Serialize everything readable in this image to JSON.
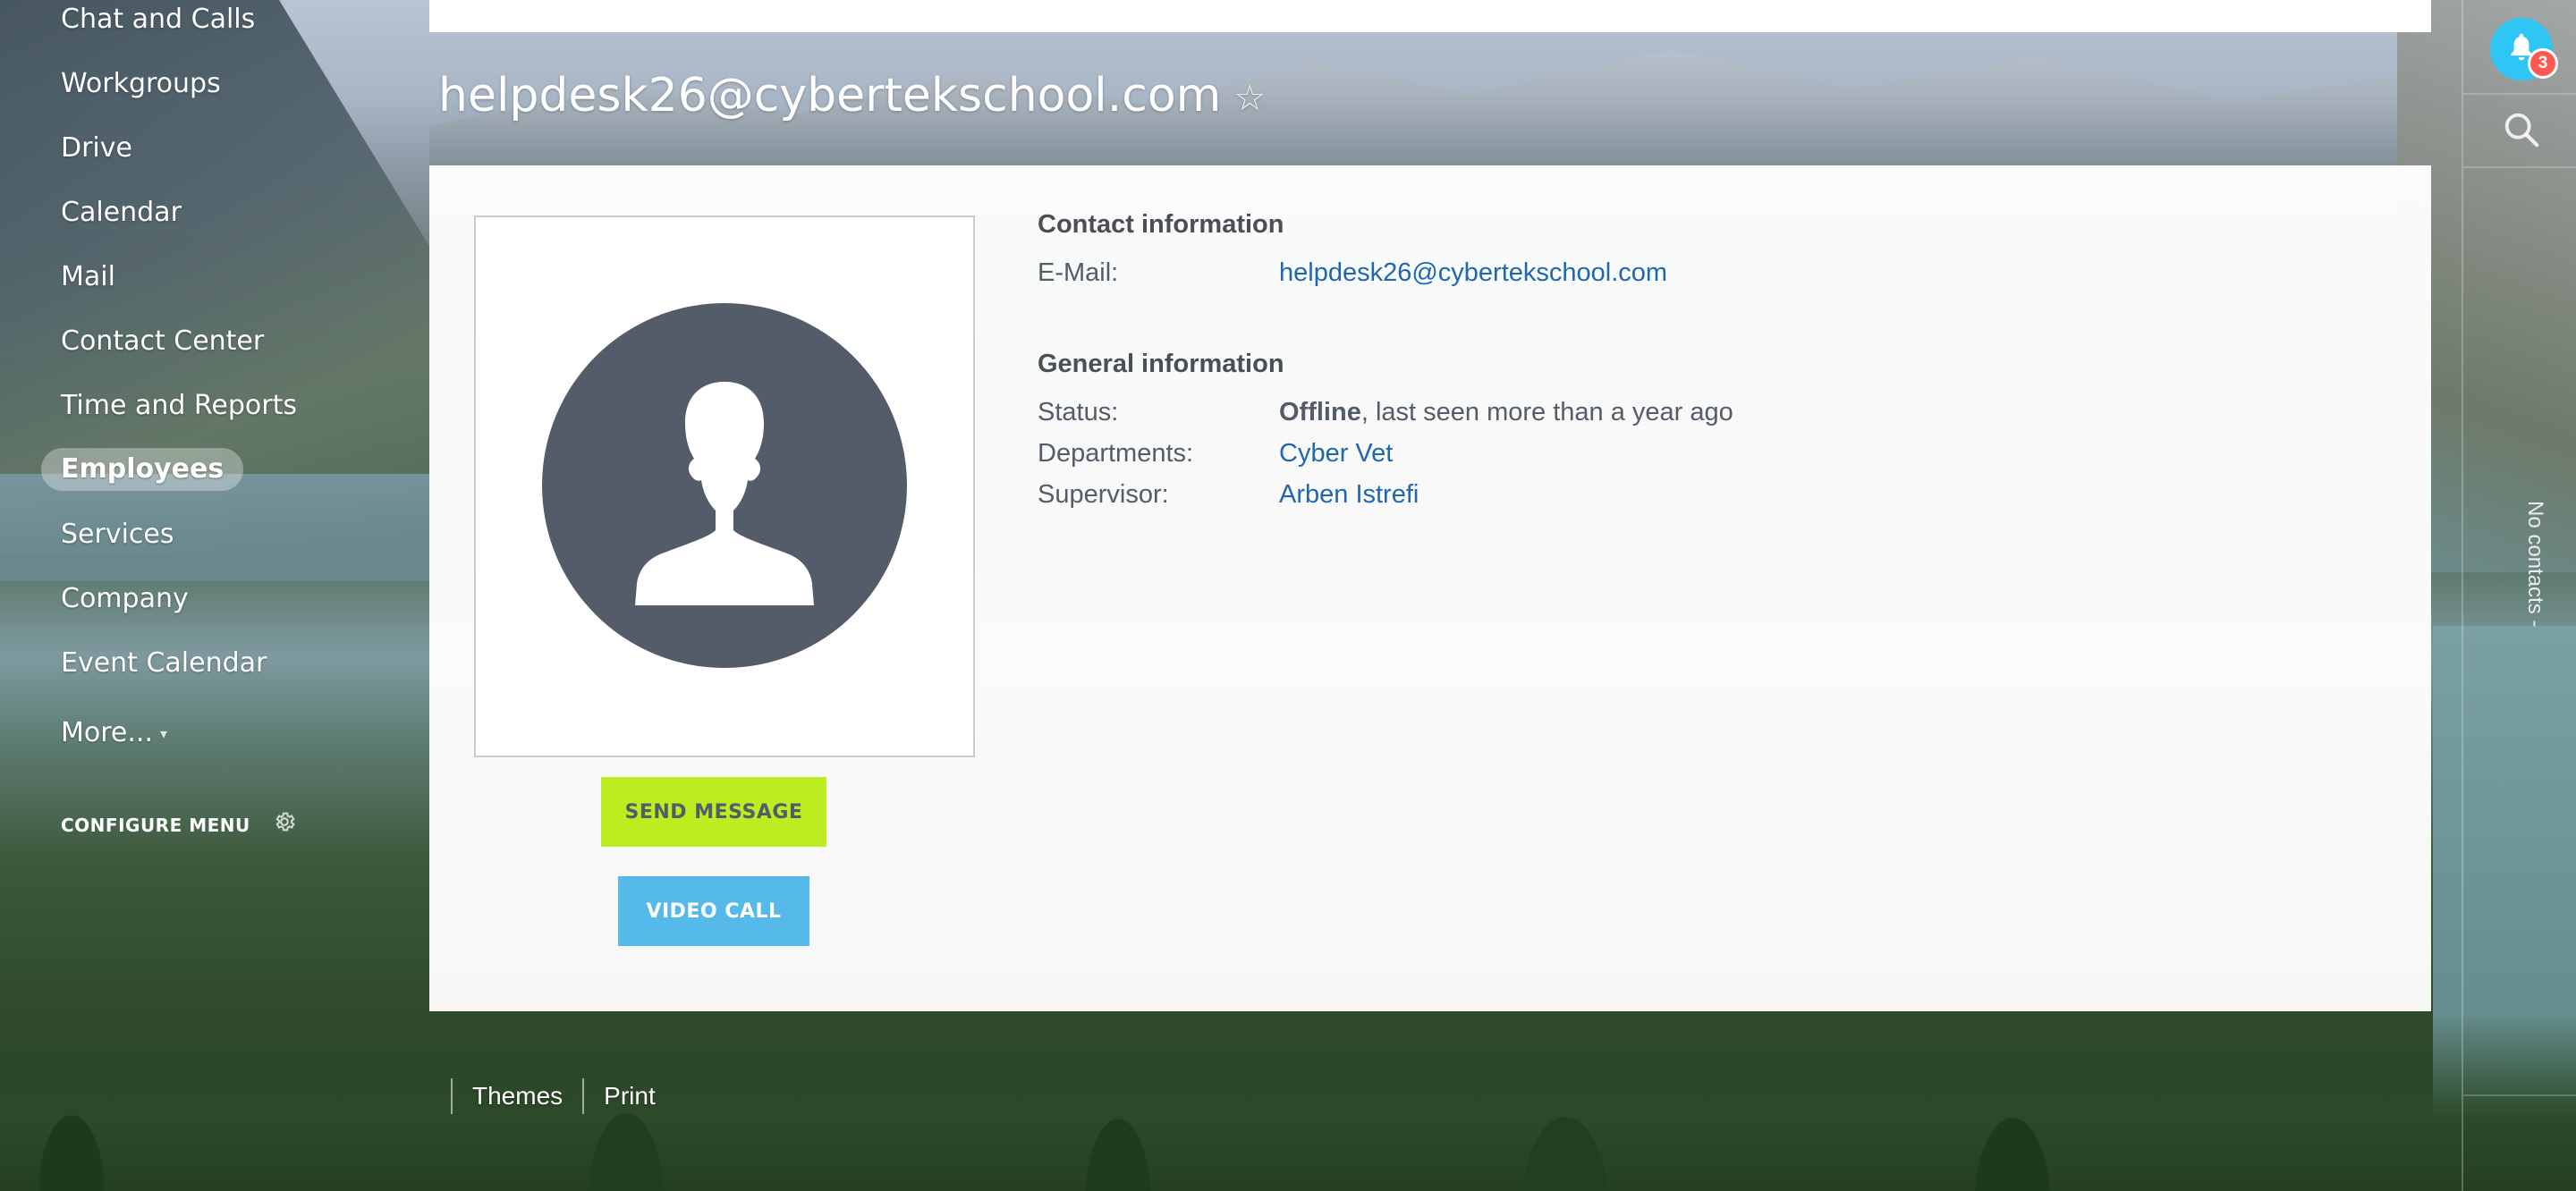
{
  "sidebar": {
    "items": [
      {
        "label": "Chat and Calls"
      },
      {
        "label": "Workgroups"
      },
      {
        "label": "Drive"
      },
      {
        "label": "Calendar"
      },
      {
        "label": "Mail"
      },
      {
        "label": "Contact Center"
      },
      {
        "label": "Time and Reports"
      },
      {
        "label": "Employees",
        "active": true
      },
      {
        "label": "Services"
      },
      {
        "label": "Company"
      },
      {
        "label": "Event Calendar"
      },
      {
        "label": "More..."
      }
    ],
    "configure_menu": "CONFIGURE MENU"
  },
  "page": {
    "title": "helpdesk26@cybertekschool.com",
    "star_icon": "☆"
  },
  "profile": {
    "avatar_icon": "user-silhouette-icon",
    "buttons": {
      "send_message": "SEND MESSAGE",
      "video_call": "VIDEO CALL"
    },
    "contact": {
      "title": "Contact information",
      "email_label": "E-Mail:",
      "email_value": "helpdesk26@cybertekschool.com"
    },
    "general": {
      "title": "General information",
      "status_label": "Status:",
      "status_value": "Offline",
      "status_detail": ", last seen more than a year ago",
      "departments_label": "Departments:",
      "departments_value": "Cyber Vet",
      "supervisor_label": "Supervisor:",
      "supervisor_value": "Arben Istrefi"
    }
  },
  "footer": {
    "themes": "Themes",
    "print": "Print"
  },
  "right_rail": {
    "notification_count": "3",
    "no_contacts": "No contacts -"
  },
  "colors": {
    "send_message_bg": "#bbed21",
    "video_call_bg": "#55b9ea",
    "link": "#2067b0",
    "bell": "#2fc6f6",
    "badge": "#ff5752",
    "avatar_bg": "#535c68"
  }
}
